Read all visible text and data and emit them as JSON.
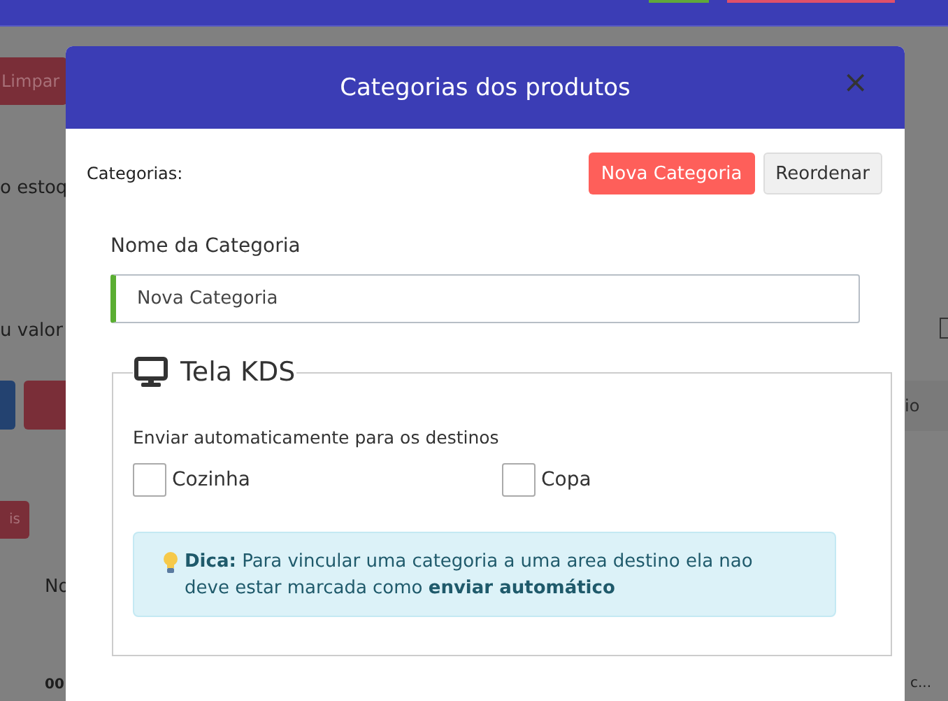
{
  "background": {
    "clear_button": "Limpar",
    "stock_label": "o estoq",
    "search_text": "u valor",
    "red_button": "is",
    "column_header": "No",
    "cell": "00",
    "side_button": "io",
    "cut_cell": "c...",
    "checkbox_checked": false
  },
  "modal": {
    "title": "Categorias dos produtos",
    "close": "×",
    "categories_label": "Categorias:",
    "buttons": [
      {
        "label": "Nova Categoria",
        "kind": "primary"
      },
      {
        "label": "Reordenar",
        "kind": "secondary"
      }
    ],
    "name_field": {
      "label": "Nome da Categoria",
      "value": "Nova Categoria"
    },
    "kds_section": {
      "title": "Tela KDS",
      "destinations_label": "Enviar automaticamente para os destinos",
      "destinations": [
        {
          "label": "Cozinha",
          "checked": false
        },
        {
          "label": "Copa",
          "checked": false
        }
      ],
      "tip": "**Dica:** Para vincular uma categoria a uma area destino ela nao deve estar marcada como **enviar automático**"
    }
  }
}
